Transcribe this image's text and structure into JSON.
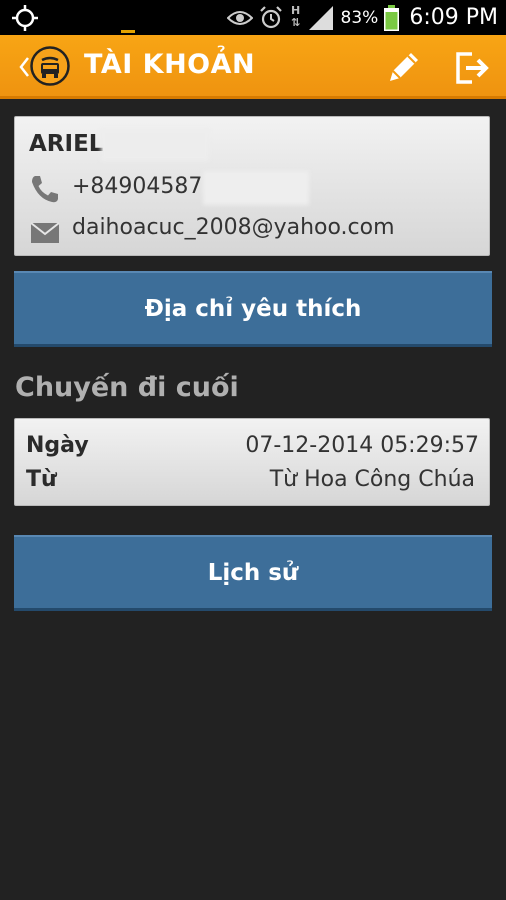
{
  "status_bar": {
    "battery": "83%",
    "time": "6:09 PM",
    "network": "H"
  },
  "action_bar": {
    "title": "TÀI KHOẢN"
  },
  "user": {
    "name": "ARIEL",
    "phone": "+84904587",
    "email": "daihoacuc_2008@yahoo.com"
  },
  "buttons": {
    "favorite_address": "Địa chỉ yêu thích",
    "history": "Lịch sử"
  },
  "last_trip": {
    "section_title": "Chuyến đi cuối",
    "date_label": "Ngày",
    "date_value": "07-12-2014 05:29:57",
    "from_label": "Từ",
    "from_value": "Từ Hoa Công Chúa"
  },
  "colors": {
    "accent": "#f39c12",
    "button": "#3d6e99",
    "background": "#222222"
  }
}
